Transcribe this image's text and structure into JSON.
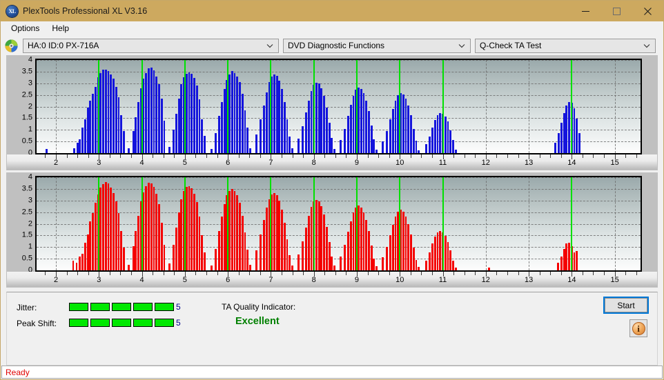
{
  "window": {
    "title": "PlexTools Professional XL V3.16",
    "app_icon": "xl-logo-icon",
    "minimize_label": "–",
    "maximize_label": "□",
    "close_label": "✕"
  },
  "menubar": {
    "items": [
      {
        "label": "Options"
      },
      {
        "label": "Help"
      }
    ]
  },
  "toolbar": {
    "drive_icon": "optical-disc-icon",
    "drive_select": "HA:0 ID:0  PX-716A",
    "function_select": "DVD Diagnostic Functions",
    "test_select": "Q-Check TA Test"
  },
  "status": {
    "jitter_label": "Jitter:",
    "jitter_value": "5",
    "jitter_segments": 5,
    "peak_shift_label": "Peak Shift:",
    "peak_shift_value": "5",
    "peak_shift_segments": 5,
    "meter_total_segments": 5,
    "tqi_label": "TA Quality Indicator:",
    "tqi_value": "Excellent",
    "tqi_color": "#008000",
    "start_label": "Start",
    "info_icon": "info-icon",
    "info_glyph": "i",
    "statusbar_text": "Ready",
    "statusbar_color": "#e00000"
  },
  "chart_data": [
    {
      "type": "bar",
      "name": "jitter-chart",
      "title": "",
      "xlabel": "",
      "ylabel": "",
      "color": "#1414dc",
      "marker_color": "#00e000",
      "grid": true,
      "xlim": [
        1.55,
        15.6
      ],
      "ylim": [
        0,
        4
      ],
      "yticks": [
        0,
        0.5,
        1,
        1.5,
        2,
        2.5,
        3,
        3.5,
        4
      ],
      "ytick_labels": [
        "0",
        "0.5",
        "1",
        "1.5",
        "2",
        "2.5",
        "3",
        "3.5",
        "4"
      ],
      "xticks": [
        2,
        3,
        4,
        5,
        6,
        7,
        8,
        9,
        10,
        11,
        12,
        13,
        14,
        15
      ],
      "xtick_labels": [
        "2",
        "3",
        "4",
        "5",
        "6",
        "7",
        "8",
        "9",
        "10",
        "11",
        "12",
        "13",
        "14",
        "15"
      ],
      "markers": [
        3,
        4,
        5,
        6,
        7,
        8,
        9,
        10,
        11,
        14
      ],
      "bar_width": 0.045,
      "x": [
        1.78,
        2.42,
        2.5,
        2.56,
        2.62,
        2.68,
        2.74,
        2.8,
        2.86,
        2.92,
        2.98,
        3.04,
        3.1,
        3.16,
        3.22,
        3.28,
        3.34,
        3.4,
        3.46,
        3.52,
        3.58,
        3.7,
        3.8,
        3.86,
        3.92,
        3.98,
        4.04,
        4.1,
        4.16,
        4.22,
        4.28,
        4.34,
        4.4,
        4.46,
        4.52,
        4.64,
        4.74,
        4.8,
        4.86,
        4.92,
        4.98,
        5.04,
        5.1,
        5.16,
        5.22,
        5.28,
        5.34,
        5.4,
        5.46,
        5.62,
        5.72,
        5.8,
        5.86,
        5.92,
        5.98,
        6.04,
        6.1,
        6.16,
        6.22,
        6.28,
        6.34,
        6.4,
        6.46,
        6.52,
        6.66,
        6.76,
        6.84,
        6.9,
        6.96,
        7.02,
        7.08,
        7.14,
        7.2,
        7.26,
        7.32,
        7.38,
        7.44,
        7.5,
        7.64,
        7.74,
        7.82,
        7.88,
        7.94,
        8.0,
        8.06,
        8.12,
        8.18,
        8.24,
        8.3,
        8.36,
        8.42,
        8.48,
        8.62,
        8.72,
        8.8,
        8.86,
        8.92,
        8.98,
        9.04,
        9.1,
        9.16,
        9.22,
        9.28,
        9.34,
        9.4,
        9.46,
        9.6,
        9.7,
        9.78,
        9.84,
        9.9,
        9.96,
        10.02,
        10.08,
        10.14,
        10.2,
        10.26,
        10.32,
        10.38,
        10.44,
        10.62,
        10.7,
        10.76,
        10.82,
        10.88,
        10.94,
        11.0,
        11.06,
        11.12,
        11.18,
        11.24,
        11.3,
        13.62,
        13.7,
        13.76,
        13.82,
        13.88,
        13.94,
        14.0,
        14.06,
        14.12,
        14.18,
        14.24
      ],
      "values": [
        0.18,
        0.22,
        0.45,
        0.6,
        1.1,
        1.45,
        1.95,
        2.25,
        2.55,
        2.85,
        3.25,
        3.45,
        3.58,
        3.6,
        3.52,
        3.38,
        3.2,
        2.85,
        2.4,
        1.62,
        0.95,
        0.2,
        0.95,
        1.55,
        2.2,
        2.8,
        3.2,
        3.45,
        3.65,
        3.68,
        3.55,
        3.3,
        2.95,
        2.35,
        1.4,
        0.28,
        1.0,
        1.7,
        2.35,
        2.95,
        3.25,
        3.42,
        3.48,
        3.4,
        3.22,
        2.9,
        2.3,
        1.45,
        0.75,
        0.18,
        0.85,
        1.6,
        2.2,
        2.75,
        3.15,
        3.38,
        3.52,
        3.45,
        3.3,
        3.05,
        2.55,
        1.85,
        1.1,
        0.22,
        0.8,
        1.45,
        2.05,
        2.6,
        3.05,
        3.28,
        3.38,
        3.32,
        3.12,
        2.75,
        2.2,
        1.45,
        0.72,
        0.2,
        0.62,
        1.15,
        1.75,
        2.25,
        2.68,
        2.92,
        3.02,
        2.98,
        2.8,
        2.45,
        1.95,
        1.3,
        0.65,
        0.18,
        0.55,
        1.05,
        1.6,
        2.08,
        2.45,
        2.72,
        2.82,
        2.75,
        2.58,
        2.25,
        1.8,
        1.2,
        0.58,
        0.15,
        0.5,
        0.95,
        1.45,
        1.9,
        2.25,
        2.48,
        2.58,
        2.52,
        2.35,
        2.05,
        1.62,
        1.05,
        0.52,
        0.12,
        0.38,
        0.72,
        1.1,
        1.42,
        1.62,
        1.72,
        1.7,
        1.58,
        1.35,
        0.98,
        0.55,
        0.15,
        0.45,
        0.85,
        1.3,
        1.72,
        2.05,
        2.18,
        2.15,
        1.92,
        1.48,
        0.85
      ]
    },
    {
      "type": "bar",
      "name": "peak-shift-chart",
      "title": "",
      "xlabel": "",
      "ylabel": "",
      "color": "#f40000",
      "marker_color": "#00e000",
      "grid": true,
      "xlim": [
        1.55,
        15.6
      ],
      "ylim": [
        0,
        4
      ],
      "yticks": [
        0,
        0.5,
        1,
        1.5,
        2,
        2.5,
        3,
        3.5,
        4
      ],
      "ytick_labels": [
        "0",
        "0.5",
        "1",
        "1.5",
        "2",
        "2.5",
        "3",
        "3.5",
        "4"
      ],
      "xticks": [
        2,
        3,
        4,
        5,
        6,
        7,
        8,
        9,
        10,
        11,
        12,
        13,
        14,
        15
      ],
      "xtick_labels": [
        "2",
        "3",
        "4",
        "5",
        "6",
        "7",
        "8",
        "9",
        "10",
        "11",
        "12",
        "13",
        "14",
        "15"
      ],
      "markers": [
        3,
        4,
        5,
        6,
        7,
        8,
        9,
        10,
        11,
        14
      ],
      "bar_width": 0.045,
      "x": [
        2.4,
        2.48,
        2.56,
        2.62,
        2.68,
        2.74,
        2.8,
        2.86,
        2.92,
        2.98,
        3.04,
        3.1,
        3.16,
        3.22,
        3.28,
        3.34,
        3.4,
        3.46,
        3.52,
        3.58,
        3.7,
        3.8,
        3.86,
        3.92,
        3.98,
        4.04,
        4.1,
        4.16,
        4.22,
        4.28,
        4.34,
        4.4,
        4.46,
        4.52,
        4.64,
        4.74,
        4.8,
        4.86,
        4.92,
        4.98,
        5.04,
        5.1,
        5.16,
        5.22,
        5.28,
        5.34,
        5.4,
        5.46,
        5.62,
        5.72,
        5.8,
        5.86,
        5.92,
        5.98,
        6.04,
        6.1,
        6.16,
        6.22,
        6.28,
        6.34,
        6.4,
        6.46,
        6.52,
        6.66,
        6.76,
        6.84,
        6.9,
        6.96,
        7.02,
        7.08,
        7.14,
        7.2,
        7.26,
        7.32,
        7.38,
        7.44,
        7.5,
        7.64,
        7.74,
        7.82,
        7.88,
        7.94,
        8.0,
        8.06,
        8.12,
        8.18,
        8.24,
        8.3,
        8.36,
        8.42,
        8.48,
        8.62,
        8.72,
        8.8,
        8.86,
        8.92,
        8.98,
        9.04,
        9.1,
        9.16,
        9.22,
        9.28,
        9.34,
        9.4,
        9.46,
        9.6,
        9.7,
        9.78,
        9.84,
        9.9,
        9.96,
        10.02,
        10.08,
        10.14,
        10.2,
        10.26,
        10.32,
        10.38,
        10.44,
        10.62,
        10.7,
        10.76,
        10.82,
        10.88,
        10.94,
        11.0,
        11.06,
        11.12,
        11.18,
        11.24,
        11.3,
        12.08,
        13.68,
        13.76,
        13.82,
        13.88,
        13.94,
        14.0,
        14.06,
        14.12,
        14.18
      ],
      "values": [
        0.42,
        0.32,
        0.58,
        0.72,
        1.2,
        1.55,
        2.1,
        2.45,
        2.9,
        3.25,
        3.55,
        3.7,
        3.78,
        3.72,
        3.55,
        3.32,
        2.95,
        2.45,
        1.7,
        0.98,
        0.25,
        1.05,
        1.7,
        2.35,
        2.95,
        3.35,
        3.62,
        3.75,
        3.72,
        3.58,
        3.3,
        2.85,
        2.05,
        1.1,
        0.3,
        1.1,
        1.85,
        2.5,
        3.05,
        3.4,
        3.58,
        3.62,
        3.52,
        3.3,
        2.92,
        2.3,
        1.5,
        0.78,
        0.2,
        0.92,
        1.7,
        2.3,
        2.85,
        3.22,
        3.42,
        3.5,
        3.42,
        3.22,
        2.9,
        2.35,
        1.62,
        0.88,
        0.25,
        0.85,
        1.55,
        2.15,
        2.7,
        3.05,
        3.25,
        3.32,
        3.22,
        3.0,
        2.62,
        2.05,
        1.32,
        0.65,
        0.22,
        0.68,
        1.25,
        1.85,
        2.35,
        2.72,
        2.95,
        3.02,
        2.95,
        2.75,
        2.4,
        1.88,
        1.22,
        0.58,
        0.2,
        0.6,
        1.1,
        1.65,
        2.1,
        2.48,
        2.7,
        2.78,
        2.7,
        2.5,
        2.15,
        1.68,
        1.08,
        0.5,
        0.18,
        0.55,
        1.0,
        1.5,
        1.95,
        2.3,
        2.52,
        2.6,
        2.52,
        2.32,
        2.0,
        1.55,
        0.98,
        0.45,
        0.15,
        0.42,
        0.78,
        1.15,
        1.45,
        1.62,
        1.68,
        1.62,
        1.48,
        1.22,
        0.85,
        0.42,
        0.12,
        0.12,
        0.32,
        0.6,
        0.92,
        1.15,
        1.2,
        1.05,
        0.78,
        0.82
      ]
    }
  ]
}
